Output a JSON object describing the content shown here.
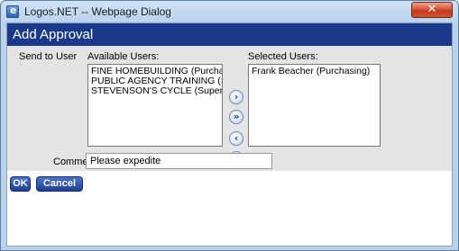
{
  "window": {
    "title": "Logos.NET -- Webpage Dialog",
    "close_glyph": "✕"
  },
  "header": {
    "title": "Add Approval"
  },
  "form": {
    "send_to_label": "Send to User",
    "available_label": "Available Users:",
    "selected_label": "Selected Users:",
    "available_users": [
      "FINE HOMEBUILDING (Purchasing)",
      "PUBLIC AGENCY TRAINING (Supervisor)",
      "STEVENSON'S CYCLE (Supervisor)"
    ],
    "selected_users": [
      "Frank Beacher (Purchasing)"
    ],
    "move_buttons": {
      "add": "›",
      "add_all": "»",
      "remove": "‹",
      "remove_all": "«"
    },
    "comments_label": "Comments",
    "comments_value": "Please expedite"
  },
  "actions": {
    "ok": "OK",
    "cancel": "Cancel"
  },
  "icons": {
    "app": "ie-icon",
    "close": "close-icon"
  },
  "colors": {
    "header_bg": "#1b3a8c",
    "panel_bg": "#e4e4e4",
    "button_bg": "#2b4fa8",
    "close_bg": "#c94326"
  }
}
